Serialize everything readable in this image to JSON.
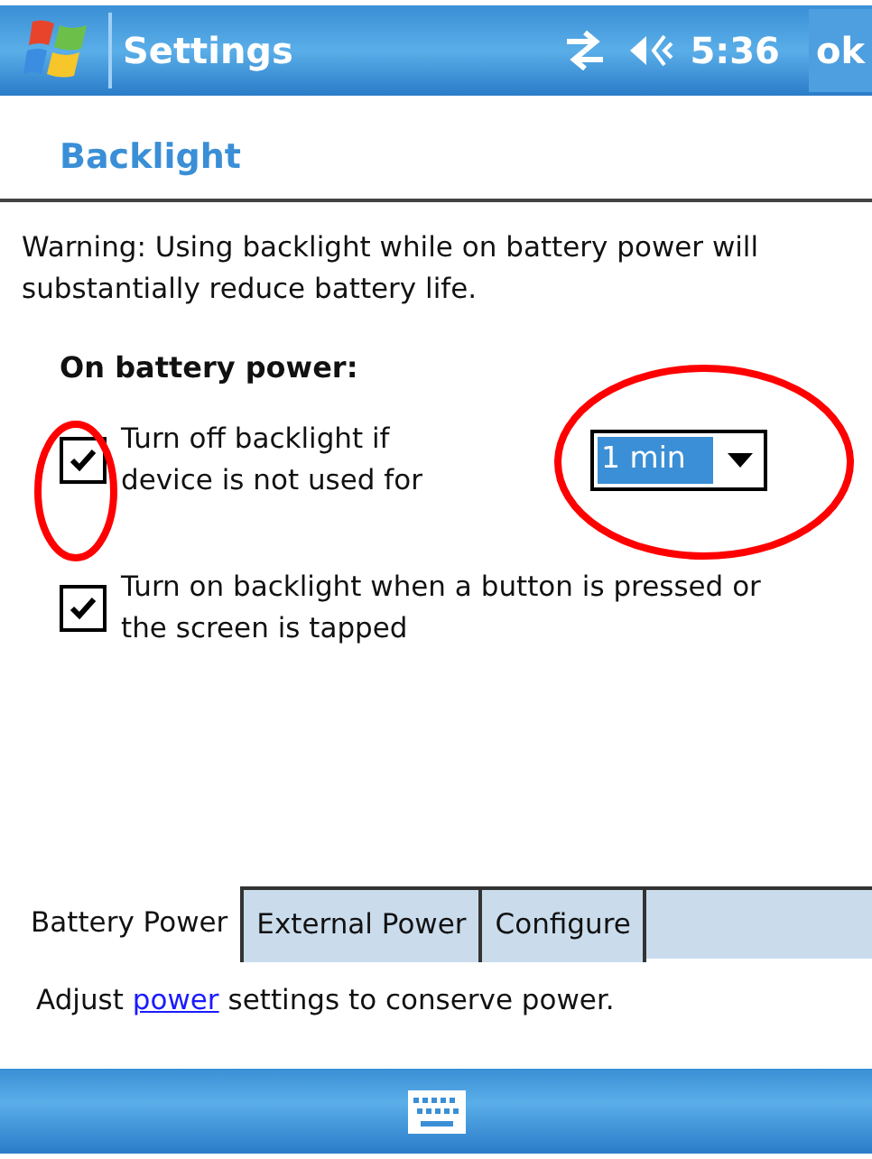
{
  "title_bar": {
    "title": "Settings",
    "time": "5:36",
    "ok_button": "ok"
  },
  "page_title": "Backlight",
  "warning": "Warning: Using backlight while on battery power will substantially reduce battery life.",
  "section_heading": "On battery power:",
  "options": [
    {
      "kind": "timeout",
      "label": "Turn off backlight if device is not used for",
      "checked": true,
      "dropdown_value": "1 min"
    },
    {
      "kind": "plain",
      "label": "Turn on backlight when a button is pressed or the screen is tapped",
      "checked": true
    }
  ],
  "tabs": [
    {
      "label": "Battery Power",
      "selected": true
    },
    {
      "label": "External Power",
      "selected": false
    },
    {
      "label": "Configure",
      "selected": false
    }
  ],
  "footer": {
    "before": "Adjust",
    "link": "power",
    "after": "settings to conserve power."
  }
}
